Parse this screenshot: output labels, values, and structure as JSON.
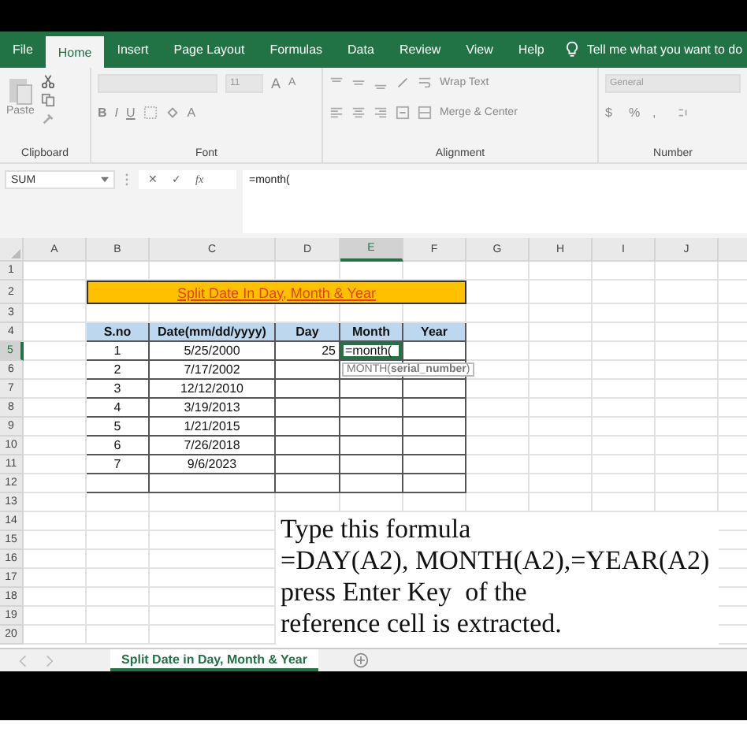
{
  "ribbon_tabs": [
    {
      "label": "File",
      "selected": false
    },
    {
      "label": "Home",
      "selected": true
    },
    {
      "label": "Insert",
      "selected": false
    },
    {
      "label": "Page Layout",
      "selected": false
    },
    {
      "label": "Formulas",
      "selected": false
    },
    {
      "label": "Data",
      "selected": false
    },
    {
      "label": "Review",
      "selected": false
    },
    {
      "label": "View",
      "selected": false
    },
    {
      "label": "Help",
      "selected": false
    }
  ],
  "tell_me": "Tell me what you want to do",
  "ribbon": {
    "clipboard": {
      "label": "Clipboard",
      "paste": "Paste"
    },
    "font": {
      "label": "Font",
      "size": "11",
      "grow": "A",
      "shrink": "A",
      "styles": [
        "B",
        "I",
        "U"
      ],
      "font_color": "A"
    },
    "alignment": {
      "label": "Alignment",
      "wrap": "Wrap Text",
      "merge": "Merge & Center"
    },
    "number": {
      "label": "Number",
      "format": "General",
      "symbols": [
        "$",
        "%",
        ","
      ]
    }
  },
  "formula_bar": {
    "name_box": "SUM",
    "cancel": "✕",
    "enter": "✓",
    "fx": "fx",
    "formula": "=month("
  },
  "columns": [
    {
      "label": "A",
      "selected": false
    },
    {
      "label": "B",
      "selected": false
    },
    {
      "label": "C",
      "selected": false
    },
    {
      "label": "D",
      "selected": false
    },
    {
      "label": "E",
      "selected": true
    },
    {
      "label": "F",
      "selected": false
    },
    {
      "label": "G",
      "selected": false
    },
    {
      "label": "H",
      "selected": false
    },
    {
      "label": "I",
      "selected": false
    },
    {
      "label": "J",
      "selected": false
    }
  ],
  "rows": [
    {
      "label": "1",
      "selected": false
    },
    {
      "label": "2",
      "selected": false
    },
    {
      "label": "3",
      "selected": false
    },
    {
      "label": "4",
      "selected": false
    },
    {
      "label": "5",
      "selected": true
    },
    {
      "label": "6",
      "selected": false
    },
    {
      "label": "7",
      "selected": false
    },
    {
      "label": "8",
      "selected": false
    },
    {
      "label": "9",
      "selected": false
    },
    {
      "label": "10",
      "selected": false
    },
    {
      "label": "11",
      "selected": false
    },
    {
      "label": "12",
      "selected": false
    },
    {
      "label": "13",
      "selected": false
    },
    {
      "label": "14",
      "selected": false
    },
    {
      "label": "15",
      "selected": false
    },
    {
      "label": "16",
      "selected": false
    },
    {
      "label": "17",
      "selected": false
    },
    {
      "label": "18",
      "selected": false
    },
    {
      "label": "19",
      "selected": false
    },
    {
      "label": "20",
      "selected": false
    }
  ],
  "title": "Split Date In Day, Month & Year",
  "table": {
    "headers": [
      "S.no",
      "Date(mm/dd/yyyy)",
      "Day",
      "Month",
      "Year"
    ],
    "rows": [
      [
        "1",
        "5/25/2000",
        "25"
      ],
      [
        "2",
        "7/17/2002"
      ],
      [
        "3",
        "12/12/2010"
      ],
      [
        "4",
        "3/19/2013"
      ],
      [
        "5",
        "1/21/2015"
      ],
      [
        "6",
        "7/26/2018"
      ],
      [
        "7",
        "9/6/2023"
      ]
    ]
  },
  "active_cell": {
    "text": "=month(",
    "tooltip": "MONTH(**serial_number**)"
  },
  "caption": [
    "Type this formula",
    "=DAY(A2), MONTH(A2),=YEAR(A2)",
    "press Enter Key  of the",
    "reference cell is extracted."
  ],
  "sheet_tabs": [
    {
      "label": "Split Date in Day, Month & Year",
      "selected": true
    }
  ]
}
